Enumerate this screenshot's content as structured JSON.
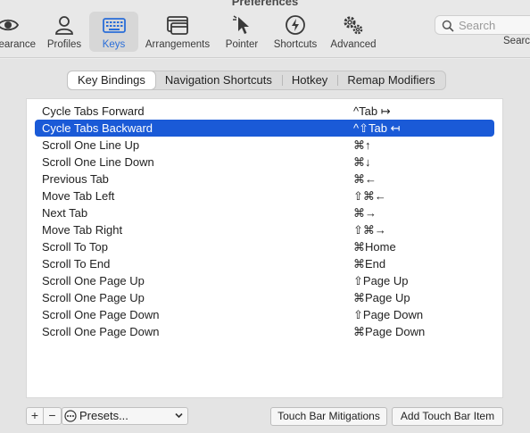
{
  "window": {
    "title": "Preferences"
  },
  "toolbar": {
    "items": [
      {
        "label": "Appearance",
        "icon": "eye-icon"
      },
      {
        "label": "Profiles",
        "icon": "person-icon"
      },
      {
        "label": "Keys",
        "icon": "keyboard-icon",
        "active": true
      },
      {
        "label": "Arrangements",
        "icon": "windows-icon"
      },
      {
        "label": "Pointer",
        "icon": "pointer-icon"
      },
      {
        "label": "Shortcuts",
        "icon": "lightning-icon"
      },
      {
        "label": "Advanced",
        "icon": "gears-icon"
      }
    ],
    "search": {
      "placeholder": "Search",
      "label": "Search"
    }
  },
  "tabs": [
    {
      "label": "Key Bindings",
      "selected": true
    },
    {
      "label": "Navigation Shortcuts"
    },
    {
      "label": "Hotkey"
    },
    {
      "label": "Remap Modifiers"
    }
  ],
  "bindings": [
    {
      "action": "Cycle Tabs Forward",
      "shortcut": "^Tab ↦"
    },
    {
      "action": "Cycle Tabs Backward",
      "shortcut": "^⇧Tab ↤",
      "selected": true
    },
    {
      "action": "Scroll One Line Up",
      "shortcut": "⌘↑"
    },
    {
      "action": "Scroll One Line Down",
      "shortcut": "⌘↓"
    },
    {
      "action": "Previous Tab",
      "shortcut": "⌘←"
    },
    {
      "action": "Move Tab Left",
      "shortcut": "⇧⌘←"
    },
    {
      "action": "Next Tab",
      "shortcut": "⌘→"
    },
    {
      "action": "Move Tab Right",
      "shortcut": "⇧⌘→"
    },
    {
      "action": "Scroll To Top",
      "shortcut": "⌘Home"
    },
    {
      "action": "Scroll To End",
      "shortcut": "⌘End"
    },
    {
      "action": "Scroll One Page Up",
      "shortcut": "⇧Page Up"
    },
    {
      "action": "Scroll One Page Up",
      "shortcut": "⌘Page Up"
    },
    {
      "action": "Scroll One Page Down",
      "shortcut": "⇧Page Down"
    },
    {
      "action": "Scroll One Page Down",
      "shortcut": "⌘Page Down"
    }
  ],
  "bottom": {
    "add_label": "+",
    "remove_label": "−",
    "presets_label": "Presets...",
    "touch_bar_mitigations": "Touch Bar Mitigations",
    "add_touch_bar_item": "Add Touch Bar Item"
  },
  "colors": {
    "accent": "#2a6ed8",
    "selection": "#1a5ad7"
  }
}
